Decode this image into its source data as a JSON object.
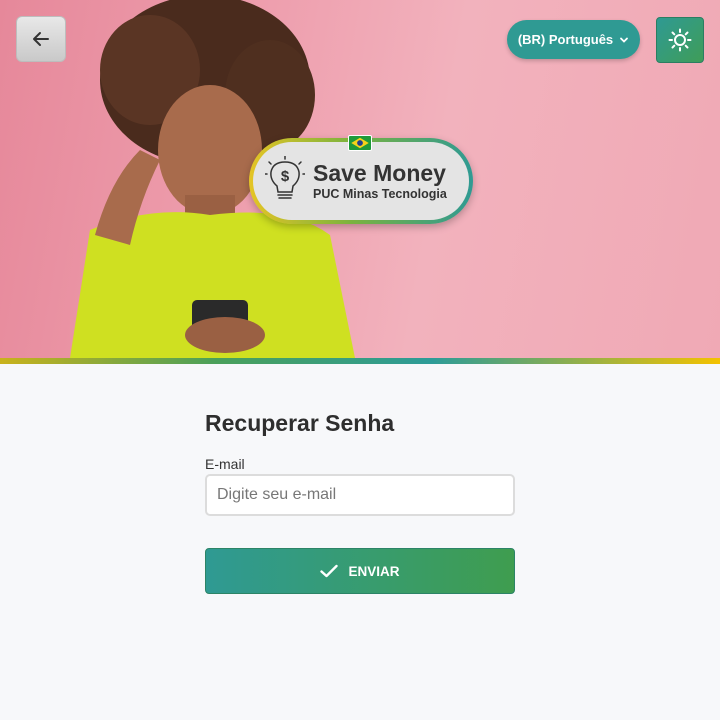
{
  "header": {
    "back_icon": "arrow-left-icon",
    "language_label": "(BR) Português",
    "language_icon": "chevron-down-icon",
    "theme_icon": "sun-icon"
  },
  "badge": {
    "title": "Save Money",
    "subtitle": "PUC Minas Tecnologia",
    "icon": "lightbulb-dollar-icon",
    "flag_icon": "brazil-flag-icon"
  },
  "form": {
    "title": "Recuperar Senha",
    "email_label": "E-mail",
    "email_value": "",
    "email_placeholder": "Digite seu e-mail",
    "submit_label": "ENVIAR",
    "submit_icon": "check-icon"
  },
  "colors": {
    "accent_teal": "#2f9a93",
    "accent_green": "#3f9d4f",
    "hero_pink": "#f0a9b5",
    "shirt_yellow": "#cfe021"
  }
}
